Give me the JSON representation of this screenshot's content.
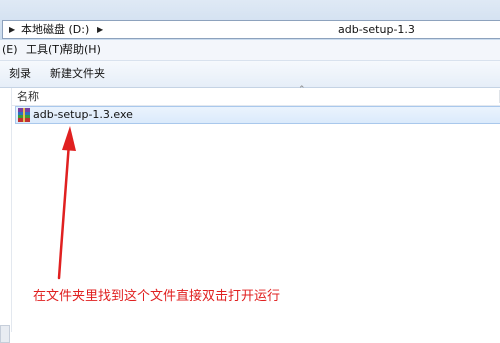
{
  "address_bar": {
    "segments": [
      "本地磁盘 (D:)"
    ],
    "current_folder": "adb-setup-1.3"
  },
  "menu": {
    "items": [
      "(E)",
      "工具(T)",
      "帮助(H)"
    ]
  },
  "toolbar": {
    "buttons": [
      "刻录",
      "新建文件夹"
    ]
  },
  "file_list": {
    "column_name": "名称",
    "files": [
      {
        "name": "adb-setup-1.3.exe",
        "icon": "winrar-archive-icon",
        "selected": true
      }
    ]
  },
  "annotation": {
    "text": "在文件夹里找到这个文件直接双击打开运行",
    "color": "#e02020"
  }
}
